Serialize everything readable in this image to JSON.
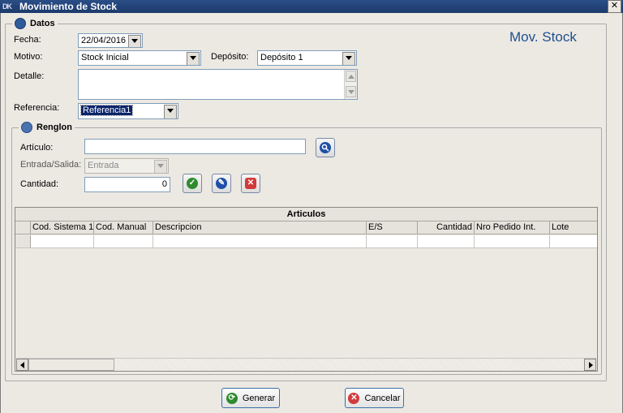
{
  "window": {
    "title": "Movimiento de Stock",
    "logo_text": "DK",
    "close_glyph": "✕"
  },
  "header": {
    "label": "Mov. Stock"
  },
  "datos": {
    "legend": "Datos",
    "fecha": {
      "label": "Fecha:",
      "value": "22/04/2016"
    },
    "motivo": {
      "label": "Motivo:",
      "value": "Stock Inicial"
    },
    "deposito": {
      "label": "Depósito:",
      "value": "Depósito 1"
    },
    "detalle": {
      "label": "Detalle:",
      "value": ""
    },
    "referencia": {
      "label": "Referencia:",
      "value": "Referencia1"
    }
  },
  "renglon": {
    "legend": "Renglon",
    "articulo": {
      "label": "Artículo:",
      "value": ""
    },
    "entrada_salida": {
      "label": "Entrada/Salida:",
      "value": "Entrada"
    },
    "cantidad": {
      "label": "Cantidad:",
      "value": "0"
    }
  },
  "grid": {
    "title": "Articulos",
    "columns": [
      "Cod. Sistema 1",
      "Cod. Manual",
      "Descripcion",
      "E/S",
      "Cantidad",
      "Nro Pedido Int.",
      "Lote"
    ]
  },
  "buttons": {
    "generar": "Generar",
    "cancelar": "Cancelar"
  },
  "colors": {
    "title_bar": "#1c3a6c",
    "accent_text": "#1f4f8f",
    "selection": "#0a246a",
    "confirm": "#2e8b2e",
    "edit": "#1f4fa8",
    "cancel": "#d23a3a"
  }
}
